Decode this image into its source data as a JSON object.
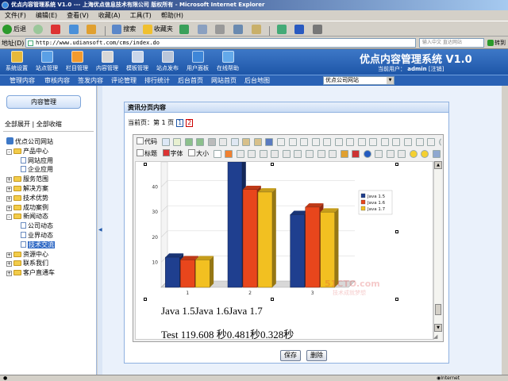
{
  "browser": {
    "title": "优点内容管理系统 V1.0 --- 上海优点信息技术有限公司 版权所有 - Microsoft Internet Explorer",
    "menu": [
      "文件(F)",
      "编辑(E)",
      "查看(V)",
      "收藏(A)",
      "工具(T)",
      "帮助(H)"
    ],
    "toolbar": {
      "back": "后退",
      "search": "搜索",
      "favorites": "收藏夹"
    },
    "address_label": "地址(D)",
    "address": "http://www.udiansoft.com/cms/index.do",
    "address_hint": "输入中文 直达网站",
    "go": "转到",
    "status_text": "Internet"
  },
  "app": {
    "title": "优点内容管理系统 V1.0",
    "user_label": "当前用户：",
    "user_name": "admin",
    "logout": "[注销]",
    "nav": [
      {
        "label": "系统设置",
        "color": "#e7b93a"
      },
      {
        "label": "站点管理",
        "color": "#5aa0e6"
      },
      {
        "label": "栏目管理",
        "color": "#f29a2e"
      },
      {
        "label": "内容管理",
        "color": "#d7d7d7"
      },
      {
        "label": "模板管理",
        "color": "#c9d6ea"
      },
      {
        "label": "站点发布",
        "color": "#b9c6da"
      },
      {
        "label": "用户面板",
        "color": "#3e86d8"
      },
      {
        "label": "在线帮助",
        "color": "#63a9ea"
      }
    ],
    "subnav": [
      "管理内容",
      "审核内容",
      "签发内容",
      "评论管理",
      "排行统计",
      "后台首页",
      "网站首页",
      "后台地图"
    ],
    "site_select": "优点公司网站"
  },
  "sidebar": {
    "button": "内容管理",
    "expand_all": "全部展开",
    "collapse_all": "全部收缩",
    "tree": [
      {
        "label": "优点公司网站",
        "level": 0,
        "kind": "root"
      },
      {
        "label": "产品中心",
        "level": 1,
        "kind": "folder",
        "toggle": "-"
      },
      {
        "label": "网站应用",
        "level": 2,
        "kind": "doc"
      },
      {
        "label": "企业应用",
        "level": 2,
        "kind": "doc"
      },
      {
        "label": "服务范围",
        "level": 1,
        "kind": "folder",
        "toggle": "+"
      },
      {
        "label": "解决方案",
        "level": 1,
        "kind": "folder",
        "toggle": "+"
      },
      {
        "label": "技术优势",
        "level": 1,
        "kind": "folder",
        "toggle": "+"
      },
      {
        "label": "成功案例",
        "level": 1,
        "kind": "folder",
        "toggle": "+"
      },
      {
        "label": "新闻动态",
        "level": 1,
        "kind": "folder",
        "toggle": "-"
      },
      {
        "label": "公司动态",
        "level": 2,
        "kind": "doc"
      },
      {
        "label": "业界动态",
        "level": 2,
        "kind": "doc"
      },
      {
        "label": "技术交流",
        "level": 2,
        "kind": "doc",
        "selected": true
      },
      {
        "label": "资源中心",
        "level": 1,
        "kind": "folder",
        "toggle": "+"
      },
      {
        "label": "联系我们",
        "level": 1,
        "kind": "folder",
        "toggle": "+"
      },
      {
        "label": "客户直通车",
        "level": 1,
        "kind": "folder",
        "toggle": "+"
      }
    ]
  },
  "panel": {
    "title": "资讯分页内容",
    "current_page_label": "当前页：第 1 页",
    "pages": [
      "1",
      "2"
    ],
    "editor": {
      "code_button": "代码",
      "heading_button": "标题",
      "font_button": "字体",
      "size_button": "大小",
      "text_line1": "Java 1.5Java 1.6Java 1.7",
      "text_line2": "Test 119.608 秒0.481秒0.328秒",
      "watermark_1": "51CTO.com",
      "watermark_2": "技术成就梦想"
    },
    "save_button": "保存",
    "delete_button": "删除"
  },
  "chart_data": {
    "type": "bar",
    "categories": [
      "1",
      "2",
      "3"
    ],
    "series": [
      {
        "name": "Java 1.5",
        "color": "#1f3f8f",
        "values": [
          12,
          50,
          29
        ]
      },
      {
        "name": "Java 1.6",
        "color": "#e8461c",
        "values": [
          11,
          39,
          32
        ]
      },
      {
        "name": "Java 1.7",
        "color": "#f2c021",
        "values": [
          11,
          38,
          30
        ]
      }
    ],
    "ylim": [
      0,
      50
    ],
    "yticks": [
      "10",
      "20",
      "30",
      "40"
    ],
    "legend": "right",
    "grid": true
  }
}
